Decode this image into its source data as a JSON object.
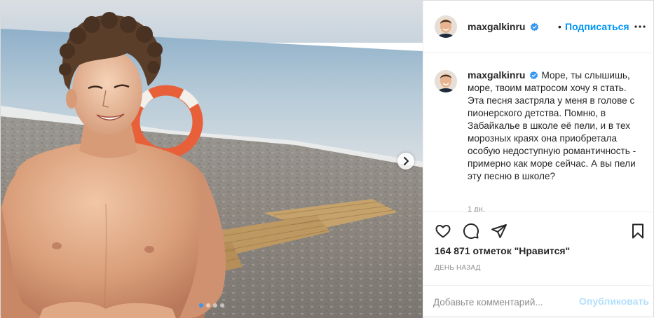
{
  "post": {
    "username": "maxgalkinru",
    "follow_label": "Подписаться",
    "bullet": "•",
    "caption": "Море, ты слышишь, море, твоим матросом хочу я стать. Эта песня застряла у меня в голове с пионерского детства. Помню, в Забайкалье в школе её пели, и в тех морозных краях она приобретала особую недоступную романтичность - примерно как море сейчас. А вы пели эту песню в школе?",
    "caption_time": "1 дн.",
    "likes": "164 871 отметок \"Нравится\"",
    "date": "ДЕНЬ НАЗАД",
    "comment_placeholder": "Добавьте комментарий...",
    "publish_label": "Опубликовать"
  },
  "carousel": {
    "total": 4,
    "active": 1
  },
  "icons": [
    "verified-badge-icon",
    "more-options-icon",
    "heart-icon",
    "comment-icon",
    "share-icon",
    "bookmark-icon",
    "chevron-right-icon"
  ],
  "colors": {
    "accent": "#0095f6",
    "publish_disabled": "#b2dffc",
    "muted": "#8e8e8e",
    "verified": "#3897f0"
  }
}
